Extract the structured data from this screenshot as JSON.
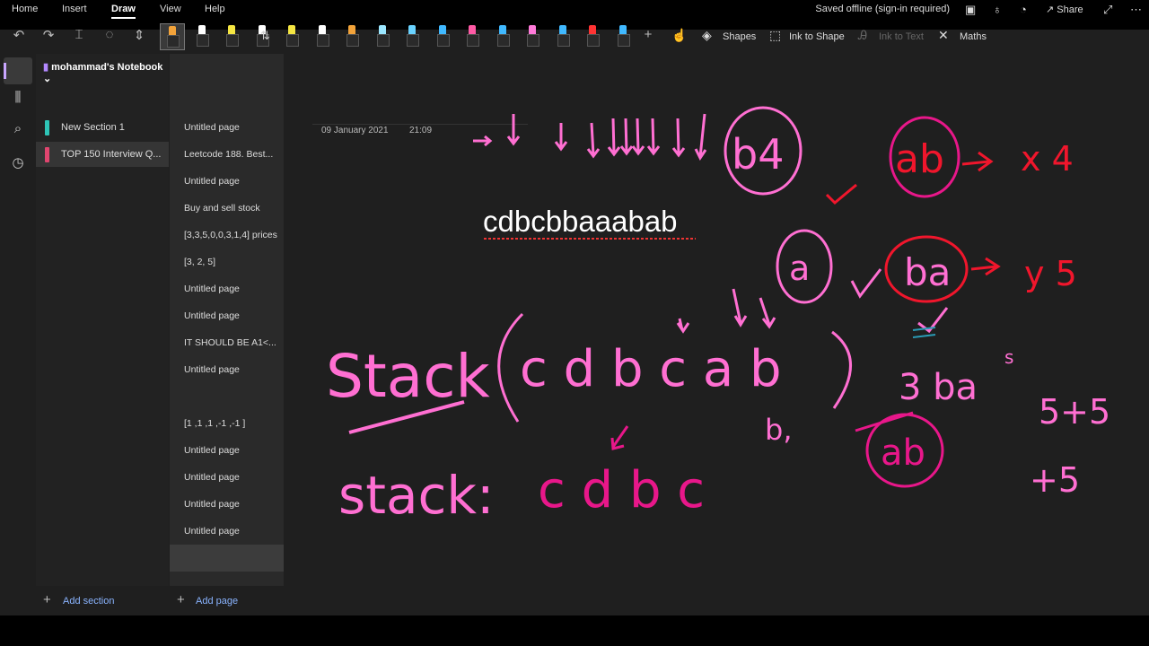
{
  "menu": {
    "items": [
      "Home",
      "Insert",
      "Draw",
      "View",
      "Help"
    ],
    "active": "Draw",
    "status": "Saved offline (sign-in required)",
    "share_label": "Share"
  },
  "toolbar": {
    "pen_colors": [
      "#f2a33a",
      "#ffffff",
      "#f5e642",
      "#ffffff",
      "#f5e642",
      "#ffffff",
      "#f2a33a",
      "#9be7ff",
      "#6ad3ff",
      "#40b9ff",
      "#ff5aa5",
      "#40b9ff",
      "#ff7ad9",
      "#40b9ff",
      "#ff3333",
      "#40b9ff"
    ],
    "shapes_label": "Shapes",
    "ink_to_shape_label": "Ink to Shape",
    "ink_to_text_label": "Ink to Text",
    "maths_label": "Maths"
  },
  "notebook": {
    "title": "mohammad's Notebook",
    "sections": [
      {
        "label": "New Section 1",
        "color": "#2ec4b6"
      },
      {
        "label": "TOP 150 Interview Q...",
        "color": "#e0456f"
      }
    ],
    "add_section_label": "Add section"
  },
  "pages": {
    "items": [
      "Untitled page",
      "Leetcode 188. Best...",
      "Untitled page",
      "Buy and sell stock",
      "[3,3,5,0,0,3,1,4] prices",
      "[3, 2, 5]",
      "Untitled page",
      "Untitled page",
      "IT SHOULD BE A1<...",
      "Untitled page",
      "",
      "[1 ,1 ,1 ,-1 ,-1 ]",
      "Untitled page",
      "Untitled page",
      "Untitled page",
      "Untitled page",
      ""
    ],
    "add_page_label": "Add page"
  },
  "canvas": {
    "date": "09 January 2021",
    "time": "21:09",
    "typed_text": "cdbcbbaaabab",
    "ink_text": {
      "stack_line1": "Stack",
      "stack_content": "c d b c a b",
      "stack_line2": "stack:",
      "stack2_content": "c d b c",
      "b4": "b4",
      "a_circle": "a",
      "ab": "ab",
      "ba": "ba",
      "x4": "x 4",
      "y5": "y 5",
      "three_bas": "3 ba",
      "ab2": "ab",
      "b_small": "b,",
      "s_small": "s",
      "five": "5+5",
      "plus5": "+5"
    }
  },
  "colors": {
    "pink": "#ff6fd2",
    "magenta": "#e8178a",
    "red": "#f0162c"
  }
}
